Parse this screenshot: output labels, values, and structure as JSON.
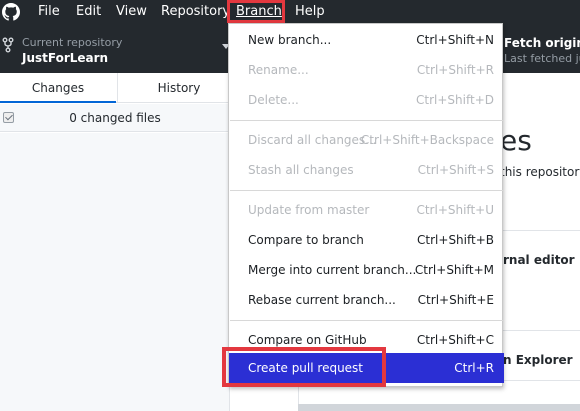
{
  "menubar": {
    "items": [
      "File",
      "Edit",
      "View",
      "Repository",
      "Branch",
      "Help"
    ],
    "app_icon": "github-icon"
  },
  "toolbar": {
    "repo_caption": "Current repository",
    "repo_name": "JustForLearn",
    "fetch_title": "Fetch origin",
    "fetch_subtitle": "Last fetched just"
  },
  "sidebar": {
    "tabs": [
      "Changes",
      "History"
    ],
    "changed_files": "0 changed files"
  },
  "main": {
    "heading": "es",
    "subtitle": "this repository.",
    "option1": "rnal editor",
    "option2": "n Explorer"
  },
  "branch_menu": {
    "items": [
      {
        "label": "New branch...",
        "shortcut": "Ctrl+Shift+N"
      },
      {
        "label": "Rename...",
        "shortcut": "Ctrl+Shift+R"
      },
      {
        "label": "Delete...",
        "shortcut": "Ctrl+Shift+D"
      },
      {
        "label": "Discard all changes...",
        "shortcut": "Ctrl+Shift+Backspace"
      },
      {
        "label": "Stash all changes",
        "shortcut": "Ctrl+Shift+S"
      },
      {
        "label": "Update from master",
        "shortcut": "Ctrl+Shift+U"
      },
      {
        "label": "Compare to branch",
        "shortcut": "Ctrl+Shift+B"
      },
      {
        "label": "Merge into current branch...",
        "shortcut": "Ctrl+Shift+M"
      },
      {
        "label": "Rebase current branch...",
        "shortcut": "Ctrl+Shift+E"
      },
      {
        "label": "Compare on GitHub",
        "shortcut": "Ctrl+Shift+C"
      },
      {
        "label": "Create pull request",
        "shortcut": "Ctrl+R"
      }
    ]
  },
  "colors": {
    "menubar_bg": "#24292e",
    "highlight_border": "#e3383f",
    "active_item_bg": "#2b2fd4",
    "disabled_text": "#b5b8bc"
  }
}
